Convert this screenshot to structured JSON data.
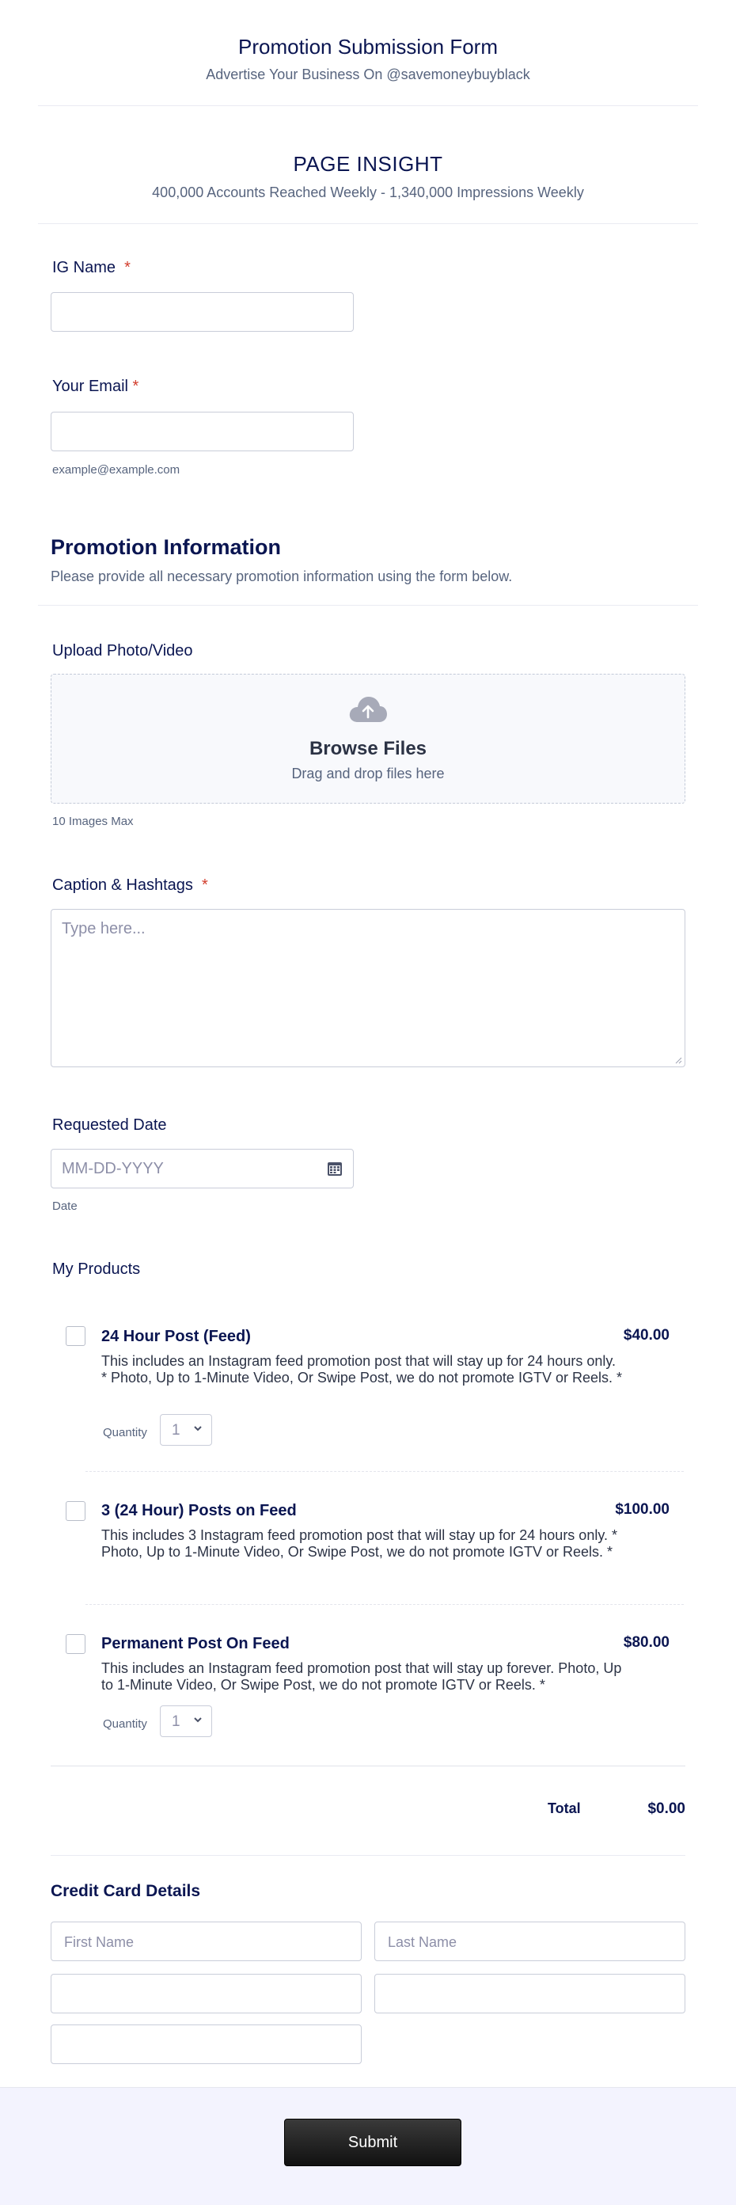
{
  "header": {
    "title": "Promotion Submission Form",
    "subtitle": "Advertise Your Business On @savemoneybuyblack"
  },
  "insight": {
    "title": "PAGE INSIGHT",
    "subtitle": "400,000 Accounts Reached Weekly - 1,340,000 Impressions Weekly"
  },
  "fields": {
    "ig_name": {
      "label": "IG Name",
      "required_mark": "*"
    },
    "email": {
      "label": "Your Email",
      "required_mark": "*",
      "sublabel": "example@example.com"
    }
  },
  "promotion": {
    "title": "Promotion Information",
    "description": "Please provide all necessary promotion information using the form below."
  },
  "upload": {
    "label": "Upload Photo/Video",
    "browse": "Browse Files",
    "drag": "Drag and drop files here",
    "sublabel": "10 Images Max"
  },
  "caption": {
    "label": "Caption & Hashtags",
    "required_mark": "*",
    "placeholder": "Type here..."
  },
  "date": {
    "label": "Requested Date",
    "placeholder": "MM-DD-YYYY",
    "sublabel": "Date"
  },
  "products": {
    "label": "My Products",
    "quantity_label": "Quantity",
    "items": [
      {
        "title": "24 Hour Post (Feed)",
        "price": "$40.00",
        "description": "This includes an Instagram feed promotion post that will stay up for 24 hours only. * Photo, Up to 1-Minute Video, Or Swipe Post, we do not promote IGTV or Reels. *",
        "quantity": "1"
      },
      {
        "title": "3 (24 Hour) Posts on Feed",
        "price": "$100.00",
        "description": "This includes 3 Instagram feed promotion post that will stay up for 24 hours only. * Photo, Up to 1-Minute Video, Or Swipe Post, we do not promote IGTV or Reels. *"
      },
      {
        "title": "Permanent Post On Feed",
        "price": "$80.00",
        "description": "This includes an Instagram feed promotion post that will stay up forever. Photo, Up to 1-Minute Video, Or Swipe Post, we do not promote IGTV or Reels. *",
        "quantity": "1"
      }
    ],
    "total_label": "Total",
    "total_value": "$0.00"
  },
  "credit_card": {
    "title": "Credit Card Details",
    "first_name_placeholder": "First Name",
    "last_name_placeholder": "Last Name"
  },
  "submit_label": "Submit",
  "colors": {
    "heading": "#0a1551",
    "muted": "#57647e",
    "required": "#d23d2c",
    "footer_bg": "#f3f3fe"
  }
}
